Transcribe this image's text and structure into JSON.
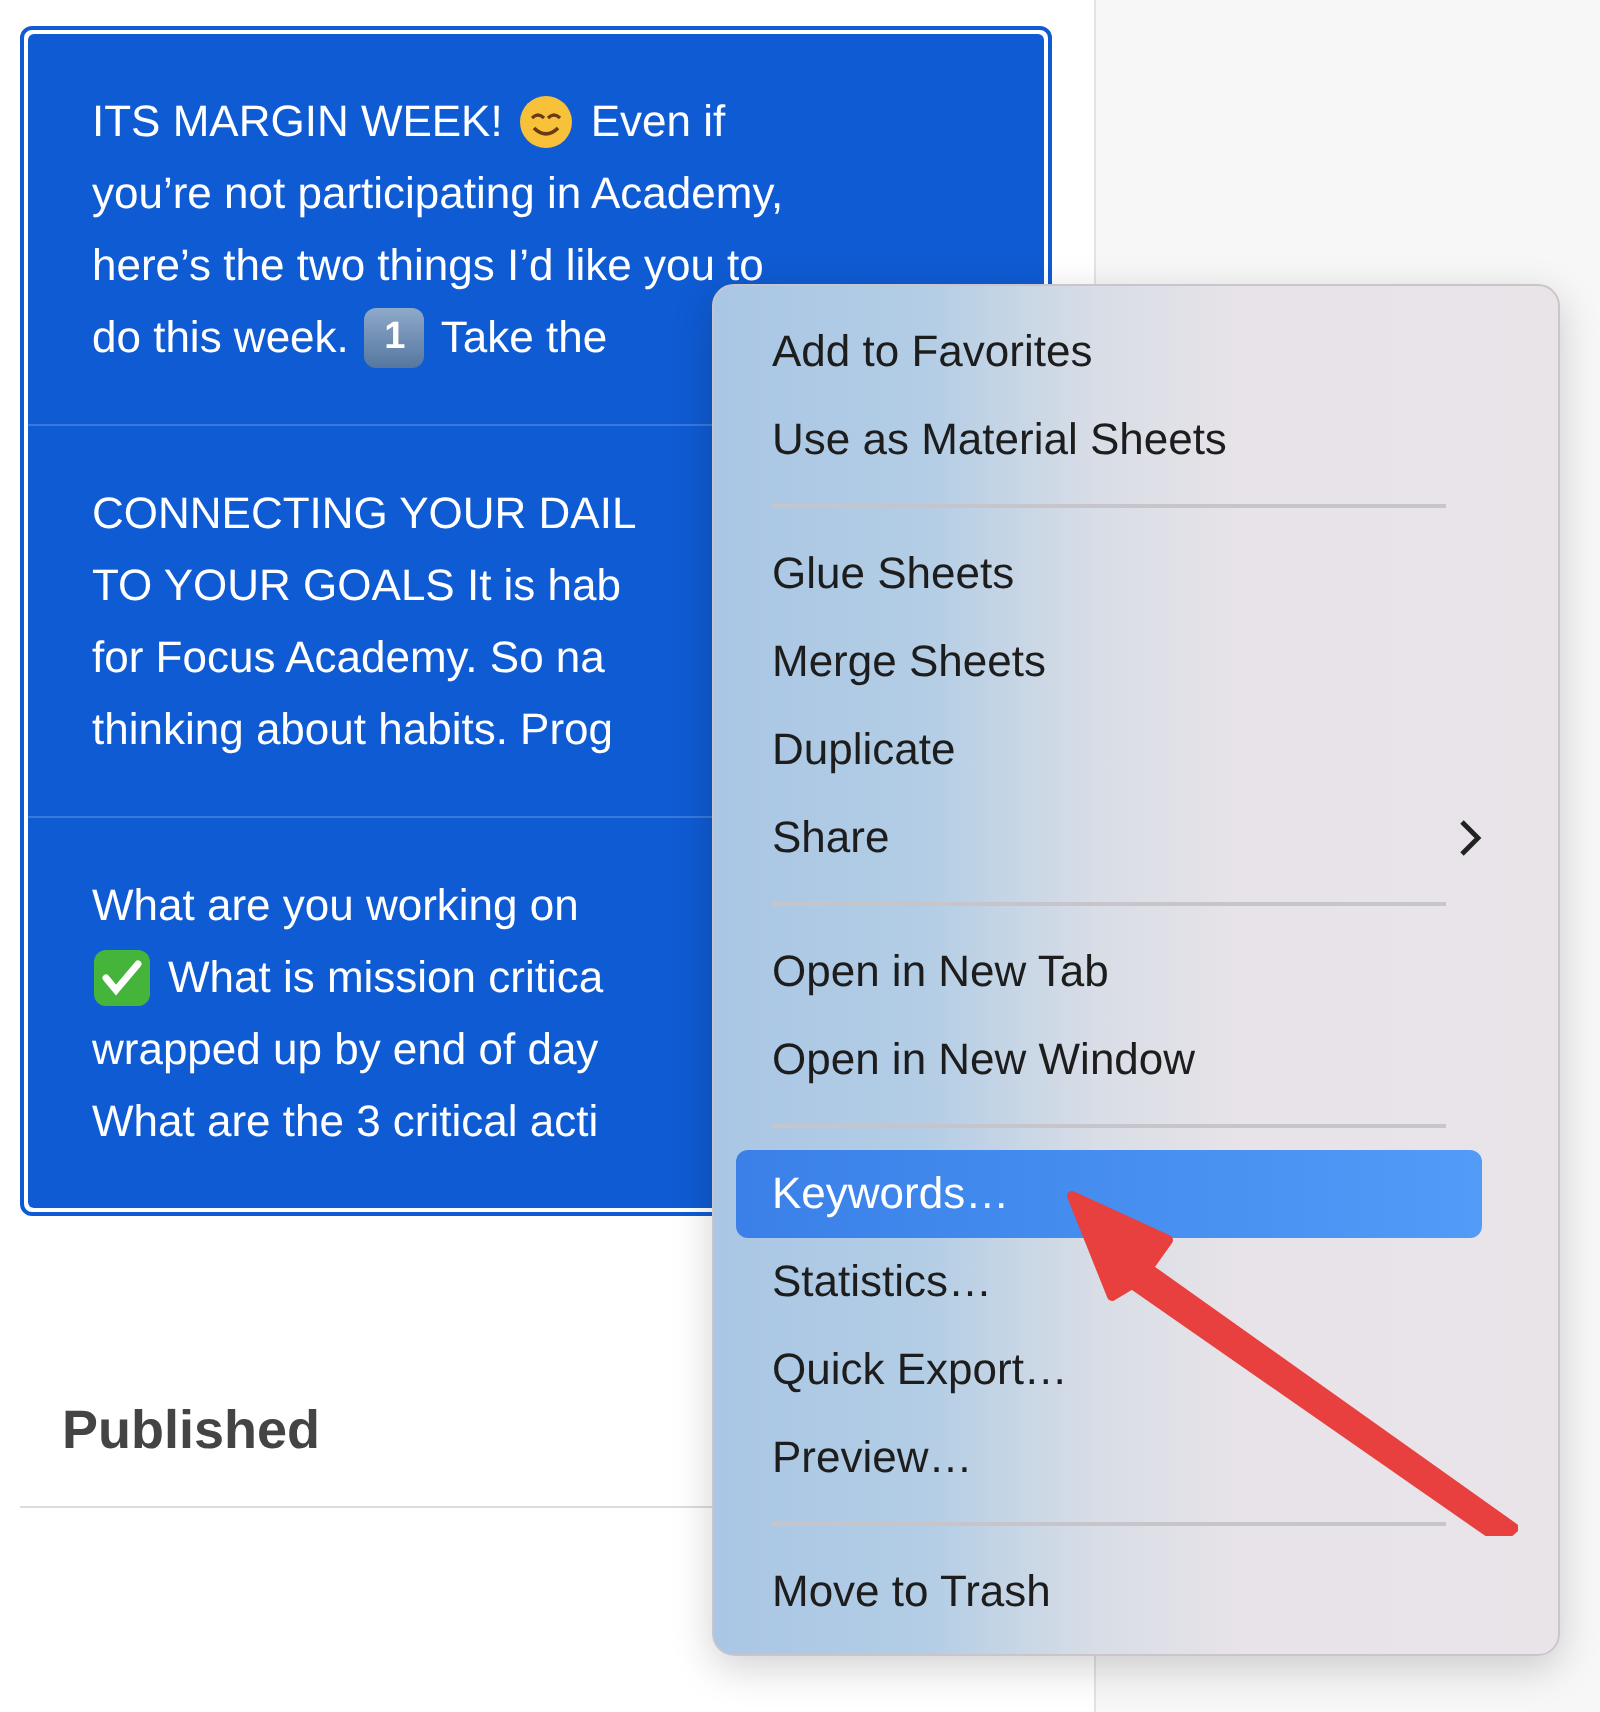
{
  "sheets": [
    {
      "selected": true,
      "lines": [
        [
          {
            "kind": "text",
            "text": "ITS MARGIN WEEK!"
          },
          {
            "kind": "smile"
          },
          {
            "kind": "text",
            "text": "Even if"
          }
        ],
        [
          {
            "kind": "text",
            "text": "you’re not participating in Academy,"
          }
        ],
        [
          {
            "kind": "text",
            "text": "here’s the two things I’d like you to"
          }
        ],
        [
          {
            "kind": "text",
            "text": "do this week."
          },
          {
            "kind": "keycap",
            "text": "1"
          },
          {
            "kind": "text",
            "text": "Take the"
          }
        ]
      ]
    },
    {
      "selected": true,
      "lines": [
        [
          {
            "kind": "text",
            "text": "CONNECTING YOUR DAIL"
          }
        ],
        [
          {
            "kind": "text",
            "text": "TO YOUR GOALS It is hab"
          }
        ],
        [
          {
            "kind": "text",
            "text": "for Focus Academy. So na"
          }
        ],
        [
          {
            "kind": "text",
            "text": "thinking about habits. Prog"
          }
        ]
      ]
    },
    {
      "selected": true,
      "lines": [
        [
          {
            "kind": "text",
            "text": "What are you working on"
          }
        ],
        [
          {
            "kind": "check"
          },
          {
            "kind": "text",
            "text": "What is mission critica"
          }
        ],
        [
          {
            "kind": "text",
            "text": "wrapped up by end of day"
          }
        ],
        [
          {
            "kind": "text",
            "text": "What are the 3 critical acti"
          }
        ]
      ]
    }
  ],
  "section_header": "Published",
  "context_menu": {
    "groups": [
      [
        {
          "label": "Add to Favorites",
          "selected": false,
          "submenu": false
        },
        {
          "label": "Use as Material Sheets",
          "selected": false,
          "submenu": false
        }
      ],
      [
        {
          "label": "Glue Sheets",
          "selected": false,
          "submenu": false
        },
        {
          "label": "Merge Sheets",
          "selected": false,
          "submenu": false
        },
        {
          "label": "Duplicate",
          "selected": false,
          "submenu": false
        },
        {
          "label": "Share",
          "selected": false,
          "submenu": true
        }
      ],
      [
        {
          "label": "Open in New Tab",
          "selected": false,
          "submenu": false
        },
        {
          "label": "Open in New Window",
          "selected": false,
          "submenu": false
        }
      ],
      [
        {
          "label": "Keywords…",
          "selected": true,
          "submenu": false
        },
        {
          "label": "Statistics…",
          "selected": false,
          "submenu": false
        },
        {
          "label": "Quick Export…",
          "selected": false,
          "submenu": false
        },
        {
          "label": "Preview…",
          "selected": false,
          "submenu": false
        }
      ],
      [
        {
          "label": "Move to Trash",
          "selected": false,
          "submenu": false
        }
      ]
    ]
  }
}
